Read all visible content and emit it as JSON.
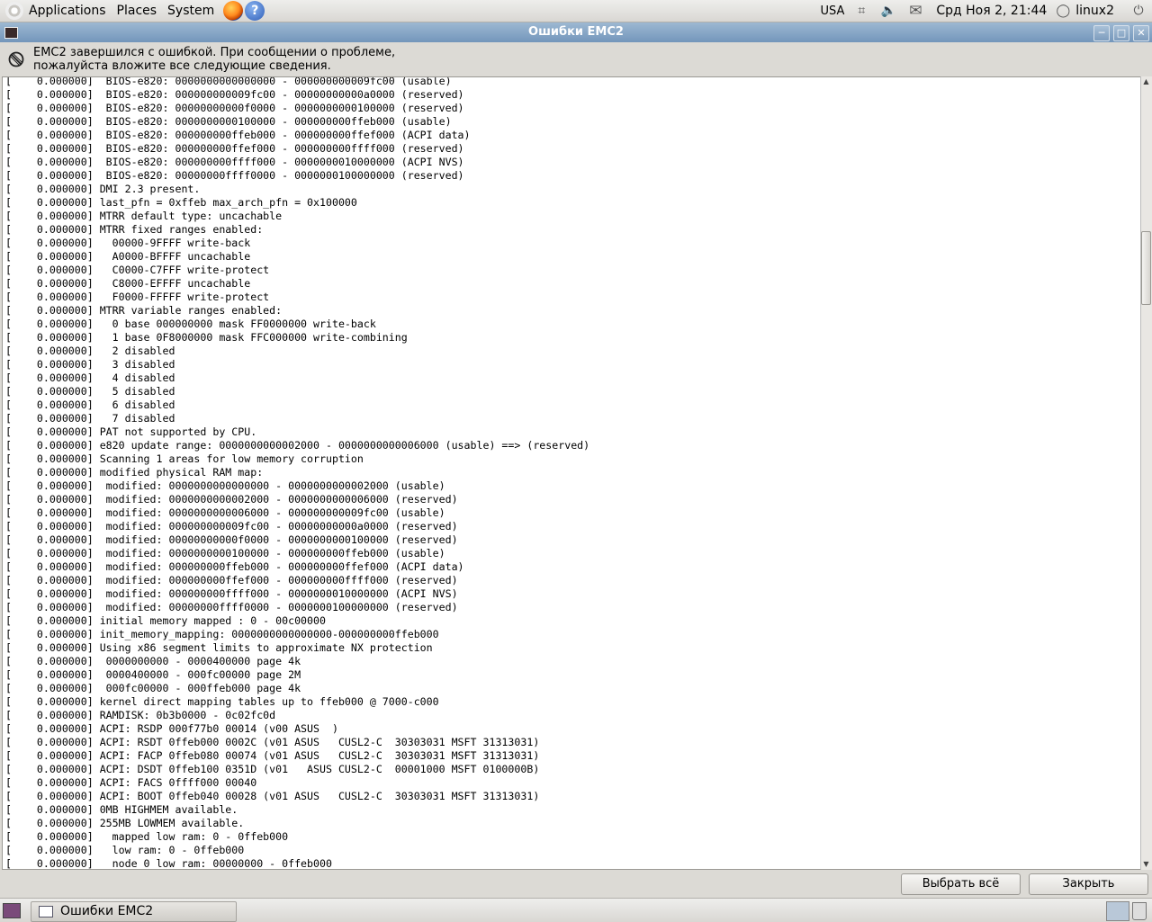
{
  "top_panel": {
    "menus": [
      "Applications",
      "Places",
      "System"
    ],
    "keyboard_layout": "USA",
    "clock": "Срд Ноя  2, 21:44",
    "user": "linux2"
  },
  "window": {
    "title": "Ошибки EMC2",
    "message_line1": "EMC2 завершился с ошибкой. При сообщении о проблеме,",
    "message_line2": "пожалуйста вложите все следующие сведения.",
    "log_lines": [
      "[    0.000000]  BIOS-e820: 0000000000000000 - 000000000009fc00 (usable)",
      "[    0.000000]  BIOS-e820: 000000000009fc00 - 00000000000a0000 (reserved)",
      "[    0.000000]  BIOS-e820: 00000000000f0000 - 0000000000100000 (reserved)",
      "[    0.000000]  BIOS-e820: 0000000000100000 - 000000000ffeb000 (usable)",
      "[    0.000000]  BIOS-e820: 000000000ffeb000 - 000000000ffef000 (ACPI data)",
      "[    0.000000]  BIOS-e820: 000000000ffef000 - 000000000ffff000 (reserved)",
      "[    0.000000]  BIOS-e820: 000000000ffff000 - 0000000010000000 (ACPI NVS)",
      "[    0.000000]  BIOS-e820: 00000000ffff0000 - 0000000100000000 (reserved)",
      "[    0.000000] DMI 2.3 present.",
      "[    0.000000] last_pfn = 0xffeb max_arch_pfn = 0x100000",
      "[    0.000000] MTRR default type: uncachable",
      "[    0.000000] MTRR fixed ranges enabled:",
      "[    0.000000]   00000-9FFFF write-back",
      "[    0.000000]   A0000-BFFFF uncachable",
      "[    0.000000]   C0000-C7FFF write-protect",
      "[    0.000000]   C8000-EFFFF uncachable",
      "[    0.000000]   F0000-FFFFF write-protect",
      "[    0.000000] MTRR variable ranges enabled:",
      "[    0.000000]   0 base 000000000 mask FF0000000 write-back",
      "[    0.000000]   1 base 0F8000000 mask FFC000000 write-combining",
      "[    0.000000]   2 disabled",
      "[    0.000000]   3 disabled",
      "[    0.000000]   4 disabled",
      "[    0.000000]   5 disabled",
      "[    0.000000]   6 disabled",
      "[    0.000000]   7 disabled",
      "[    0.000000] PAT not supported by CPU.",
      "[    0.000000] e820 update range: 0000000000002000 - 0000000000006000 (usable) ==> (reserved)",
      "[    0.000000] Scanning 1 areas for low memory corruption",
      "[    0.000000] modified physical RAM map:",
      "[    0.000000]  modified: 0000000000000000 - 0000000000002000 (usable)",
      "[    0.000000]  modified: 0000000000002000 - 0000000000006000 (reserved)",
      "[    0.000000]  modified: 0000000000006000 - 000000000009fc00 (usable)",
      "[    0.000000]  modified: 000000000009fc00 - 00000000000a0000 (reserved)",
      "[    0.000000]  modified: 00000000000f0000 - 0000000000100000 (reserved)",
      "[    0.000000]  modified: 0000000000100000 - 000000000ffeb000 (usable)",
      "[    0.000000]  modified: 000000000ffeb000 - 000000000ffef000 (ACPI data)",
      "[    0.000000]  modified: 000000000ffef000 - 000000000ffff000 (reserved)",
      "[    0.000000]  modified: 000000000ffff000 - 0000000010000000 (ACPI NVS)",
      "[    0.000000]  modified: 00000000ffff0000 - 0000000100000000 (reserved)",
      "[    0.000000] initial memory mapped : 0 - 00c00000",
      "[    0.000000] init_memory_mapping: 0000000000000000-000000000ffeb000",
      "[    0.000000] Using x86 segment limits to approximate NX protection",
      "[    0.000000]  0000000000 - 0000400000 page 4k",
      "[    0.000000]  0000400000 - 000fc00000 page 2M",
      "[    0.000000]  000fc00000 - 000ffeb000 page 4k",
      "[    0.000000] kernel direct mapping tables up to ffeb000 @ 7000-c000",
      "[    0.000000] RAMDISK: 0b3b0000 - 0c02fc0d",
      "[    0.000000] ACPI: RSDP 000f77b0 00014 (v00 ASUS  )",
      "[    0.000000] ACPI: RSDT 0ffeb000 0002C (v01 ASUS   CUSL2-C  30303031 MSFT 31313031)",
      "[    0.000000] ACPI: FACP 0ffeb080 00074 (v01 ASUS   CUSL2-C  30303031 MSFT 31313031)",
      "[    0.000000] ACPI: DSDT 0ffeb100 0351D (v01   ASUS CUSL2-C  00001000 MSFT 0100000B)",
      "[    0.000000] ACPI: FACS 0ffff000 00040",
      "[    0.000000] ACPI: BOOT 0ffeb040 00028 (v01 ASUS   CUSL2-C  30303031 MSFT 31313031)",
      "[    0.000000] 0MB HIGHMEM available.",
      "[    0.000000] 255MB LOWMEM available.",
      "[    0.000000]   mapped low ram: 0 - 0ffeb000",
      "[    0.000000]   low ram: 0 - 0ffeb000",
      "[    0.000000]   node 0 low ram: 00000000 - 0ffeb000"
    ],
    "buttons": {
      "select_all": "Выбрать всё",
      "close": "Закрыть"
    }
  },
  "taskbar": {
    "task_label": "Ошибки EMC2"
  }
}
